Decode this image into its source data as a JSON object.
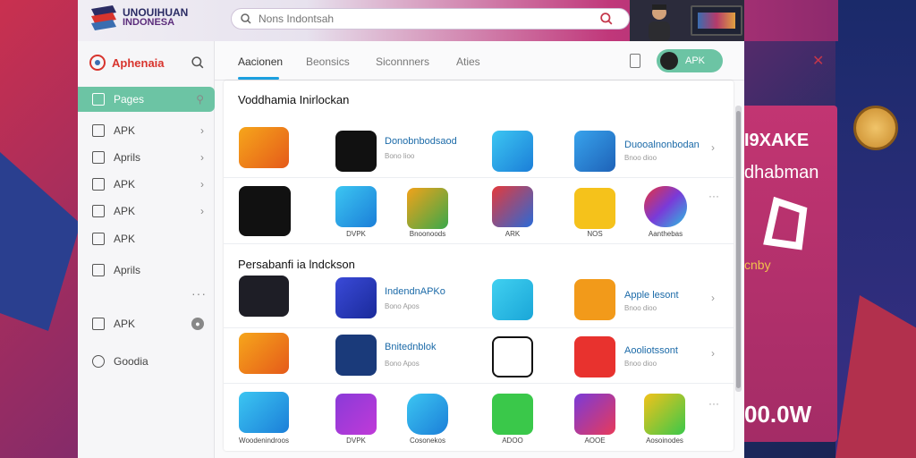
{
  "app": {
    "brand_line1": "UNOUIHUAN",
    "brand_line2": "INDONESA",
    "search_placeholder": "Nons Indontsah",
    "sidebar_title": "Aphenaia"
  },
  "sidebar": {
    "items": [
      {
        "label": "Pages",
        "icon": "grid-icon"
      },
      {
        "label": "APK",
        "icon": "apk-icon"
      },
      {
        "label": "Aprils",
        "icon": "folder-icon"
      },
      {
        "label": "APK",
        "icon": "book-icon"
      },
      {
        "label": "APK",
        "icon": "file-icon"
      },
      {
        "label": "APK",
        "icon": "upload-icon"
      },
      {
        "label": "Aprils",
        "icon": "chart-icon"
      },
      {
        "label": "APK",
        "icon": "window-icon"
      },
      {
        "label": "Goodia",
        "icon": "clock-icon"
      }
    ]
  },
  "tabs": [
    "Aacionen",
    "Beonsics",
    "Siconnners",
    "Aties"
  ],
  "apk_button": "APK",
  "sections": [
    {
      "title": "Voddhamia Inirlockan"
    },
    {
      "title": "Persabanfi ia lndckson"
    }
  ],
  "rows": [
    {
      "name1": "Donobnbodsaod",
      "sub1": "Bono lioo",
      "name2": "Duooalnonbodan",
      "sub2": "Bnoo dioo"
    },
    {
      "caps": [
        "",
        "DVPK",
        "Bnoonoods",
        "ARK",
        "NOS",
        "Aanthebas"
      ]
    },
    {
      "name1": "IndendnAPKo",
      "sub1": "Bono Apos",
      "name2": "Apple lesont",
      "sub2": "Bnoo dioo"
    },
    {
      "name1": "Bnitednblok",
      "sub1": "Bono Apos",
      "name2": "Aooliotssont",
      "sub2": "Bnoo dioo"
    },
    {
      "caps": [
        "Woodenindroos",
        "DVPK",
        "Cosonekos",
        "ADOO",
        "AOOE",
        "Aosoinodes"
      ]
    }
  ],
  "promo": {
    "line1": "I9XAKE",
    "line2": "dhabman",
    "line3": "cnby",
    "line4": "00.0W"
  },
  "colors": {
    "accent": "#6cc4a4",
    "brand": "#d8342d",
    "link": "#1b6aa8"
  }
}
